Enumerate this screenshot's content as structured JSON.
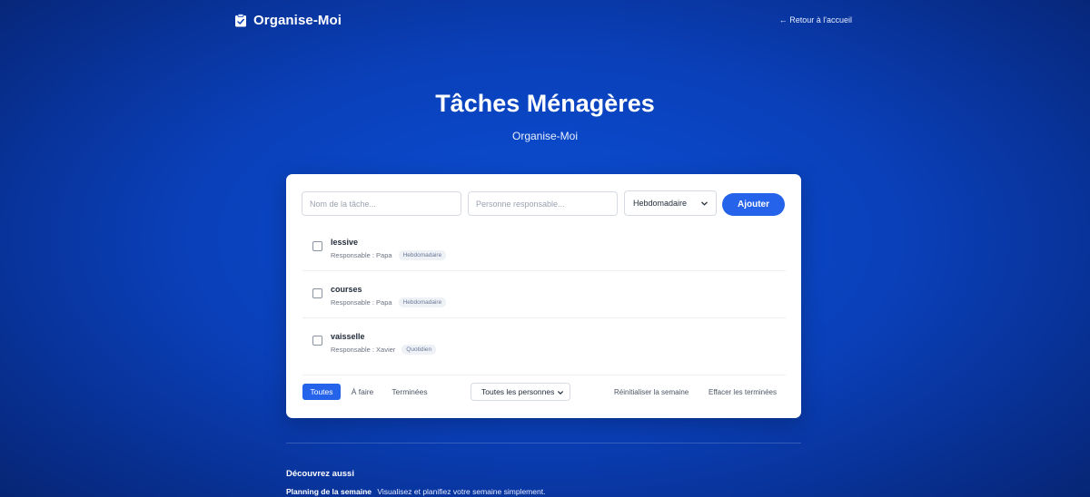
{
  "header": {
    "brand": "Organise-Moi",
    "back_link": "← Retour à l'accueil"
  },
  "hero": {
    "title": "Tâches Ménagères",
    "subtitle": "Organise-Moi"
  },
  "form": {
    "task_placeholder": "Nom de la tâche...",
    "person_placeholder": "Personne responsable...",
    "frequency_selected": "Hebdomadaire",
    "add_label": "Ajouter"
  },
  "tasks": [
    {
      "name": "lessive",
      "responsible": "Responsable : Papa",
      "frequency": "Hebdomadaire"
    },
    {
      "name": "courses",
      "responsible": "Responsable : Papa",
      "frequency": "Hebdomadaire"
    },
    {
      "name": "vaisselle",
      "responsible": "Responsable : Xavier",
      "frequency": "Quotidien"
    }
  ],
  "filters": {
    "all": "Toutes",
    "todo": "À faire",
    "done": "Terminées",
    "person_selected": "Toutes les personnes",
    "reset": "Réinitialiser la semaine",
    "clear": "Effacer les terminées"
  },
  "discover": {
    "title": "Découvrez aussi",
    "items": [
      {
        "name": "Planning de la semaine",
        "description": "Visualisez et planifiez votre semaine simplement."
      }
    ]
  },
  "colors": {
    "accent": "#2563eb",
    "background": "#0a3fb8"
  },
  "icons": {
    "brand": "clipboard-check-icon",
    "dropdown": "chevron-down-icon"
  }
}
